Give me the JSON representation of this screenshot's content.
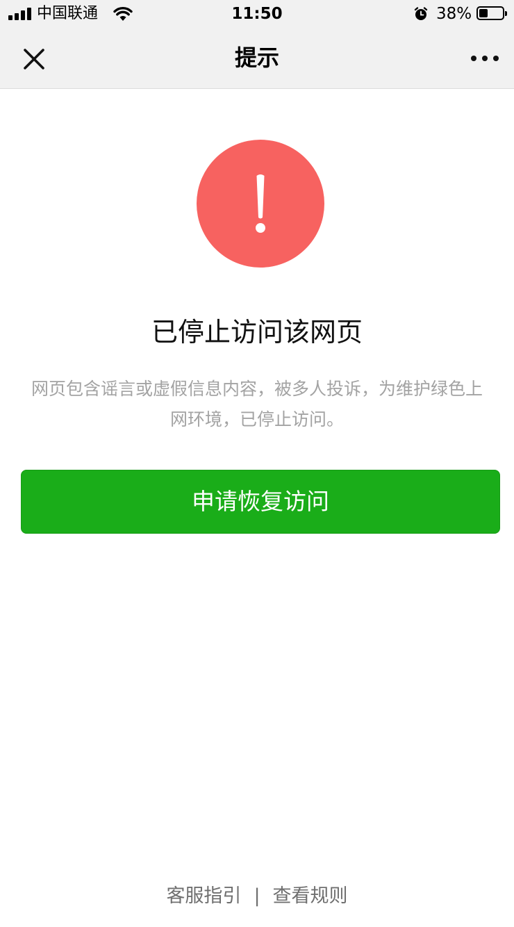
{
  "status_bar": {
    "carrier": "中国联通",
    "time": "11:50",
    "battery_percent": "38%",
    "battery_level": 0.38,
    "signal_bars": 4,
    "icons": [
      "signal-icon",
      "wifi-icon",
      "alarm-icon",
      "battery-icon"
    ]
  },
  "nav_bar": {
    "title": "提示",
    "close_icon": "close-icon",
    "more_icon": "more-icon"
  },
  "main": {
    "warning_icon": "exclamation-icon",
    "warning_color": "#f76260",
    "heading": "已停止访问该网页",
    "description": "网页包含谣言或虚假信息内容，被多人投诉，为维护绿色上网环境，已停止访问。",
    "restore_button_label": "申请恢复访问",
    "button_color": "#1aad19"
  },
  "footer": {
    "links": [
      {
        "label": "客服指引"
      },
      {
        "label": "查看规则"
      }
    ],
    "separator": "|"
  }
}
